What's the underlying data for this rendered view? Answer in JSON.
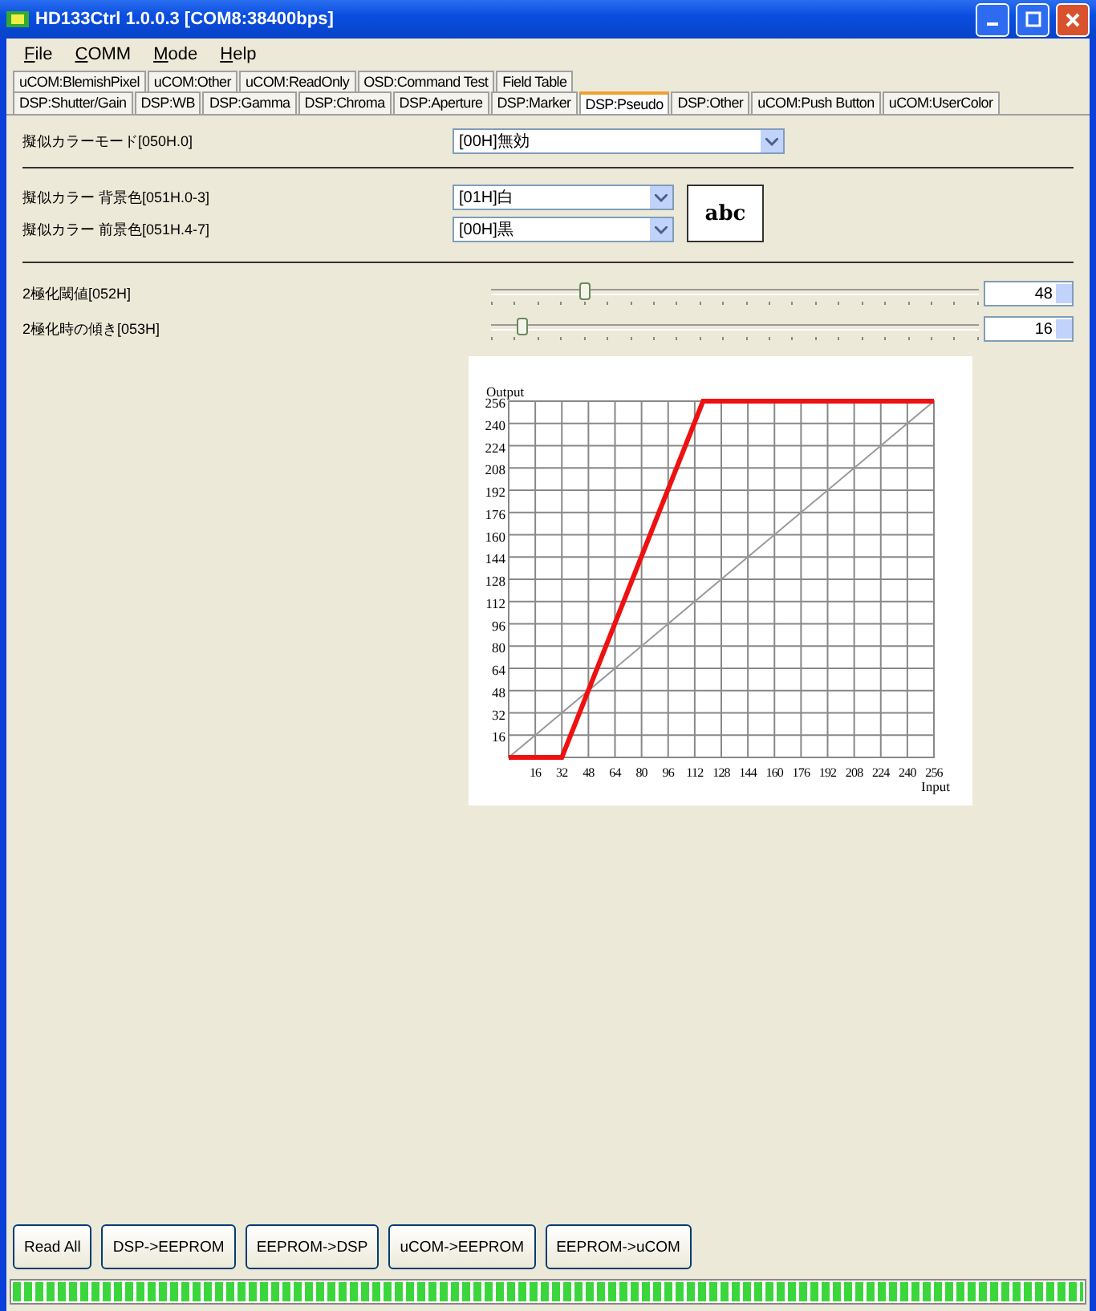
{
  "window": {
    "title": "HD133Ctrl 1.0.0.3 [COM8:38400bps]"
  },
  "menu": [
    "File",
    "COMM",
    "Mode",
    "Help"
  ],
  "tab_rows": [
    [
      {
        "label": "uCOM:BlemishPixel",
        "selected": false
      },
      {
        "label": "uCOM:Other",
        "selected": false
      },
      {
        "label": "uCOM:ReadOnly",
        "selected": false
      },
      {
        "label": "OSD:Command Test",
        "selected": false
      },
      {
        "label": "Field Table",
        "selected": false
      }
    ],
    [
      {
        "label": "DSP:Shutter/Gain",
        "selected": false
      },
      {
        "label": "DSP:WB",
        "selected": false
      },
      {
        "label": "DSP:Gamma",
        "selected": false
      },
      {
        "label": "DSP:Chroma",
        "selected": false
      },
      {
        "label": "DSP:Aperture",
        "selected": false
      },
      {
        "label": "DSP:Marker",
        "selected": false
      },
      {
        "label": "DSP:Pseudo",
        "selected": true
      },
      {
        "label": "DSP:Other",
        "selected": false
      },
      {
        "label": "uCOM:Push Button",
        "selected": false
      },
      {
        "label": "uCOM:UserColor",
        "selected": false
      }
    ]
  ],
  "mode": {
    "label": "擬似カラーモード[050H.0]",
    "value": "[00H]無効"
  },
  "colors": [
    {
      "label": "擬似カラー 背景色[051H.0-3]",
      "value": "[01H]白"
    },
    {
      "label": "擬似カラー 前景色[051H.4-7]",
      "value": "[00H]黒"
    }
  ],
  "preview": "abc",
  "sliders": [
    {
      "label": "2極化閾値[052H]",
      "level": 0.19,
      "value": "48"
    },
    {
      "label": "2極化時の傾き[053H]",
      "level": 0.0625,
      "value": "16"
    }
  ],
  "chart_data": {
    "type": "line",
    "grid": true,
    "xlabel": "Input",
    "ylabel": "Output",
    "x": [
      0,
      32,
      117,
      256
    ],
    "xlim": [
      0,
      256
    ],
    "ylim": [
      0,
      256
    ],
    "xticks": [
      16,
      32,
      48,
      64,
      80,
      96,
      112,
      128,
      144,
      160,
      176,
      192,
      208,
      224,
      240,
      256
    ],
    "yticks": [
      16,
      32,
      48,
      64,
      80,
      96,
      112,
      128,
      144,
      160,
      176,
      192,
      208,
      224,
      240,
      256
    ],
    "series": [
      {
        "color": "#ee1111",
        "values": [
          0,
          0,
          256,
          256
        ]
      },
      {
        "color": "#999999",
        "values": [
          0,
          32,
          117,
          256
        ]
      }
    ]
  },
  "buttons": [
    "Read All",
    "DSP->EEPROM",
    "EEPROM->DSP",
    "uCOM->EEPROM",
    "EEPROM->uCOM"
  ],
  "progress": {
    "level": 1
  }
}
